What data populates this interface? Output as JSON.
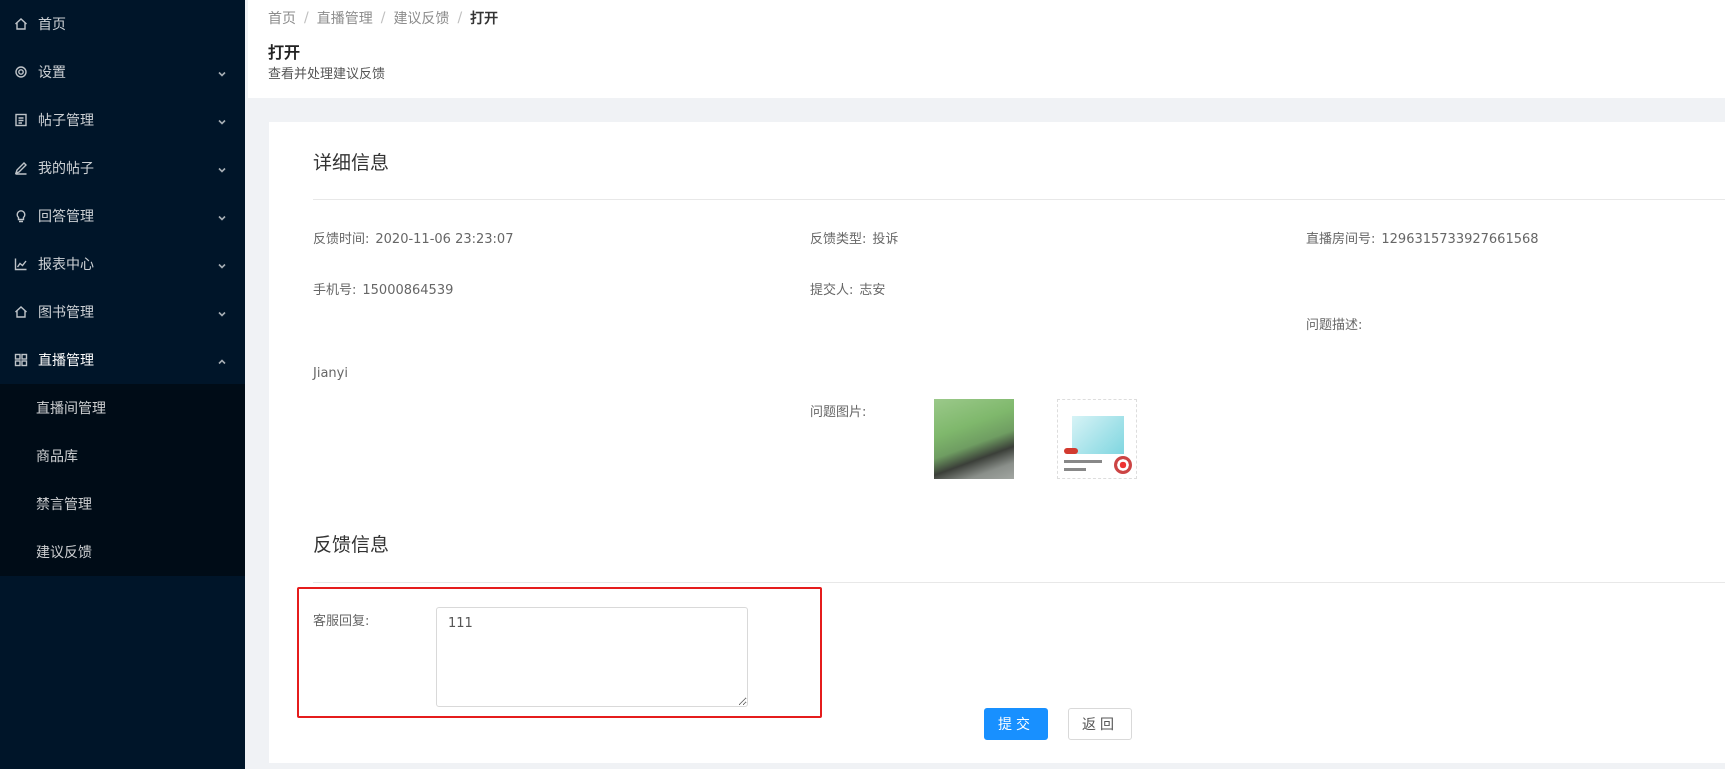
{
  "sidebar": {
    "items": [
      {
        "label": "首页",
        "icon": "home-icon"
      },
      {
        "label": "设置",
        "icon": "gear-icon"
      },
      {
        "label": "帖子管理",
        "icon": "file-text-icon"
      },
      {
        "label": "我的帖子",
        "icon": "edit-icon"
      },
      {
        "label": "回答管理",
        "icon": "bulb-icon"
      },
      {
        "label": "报表中心",
        "icon": "line-chart-icon"
      },
      {
        "label": "图书管理",
        "icon": "home-icon"
      },
      {
        "label": "直播管理",
        "icon": "appstore-icon"
      }
    ],
    "submenu": [
      "直播间管理",
      "商品库",
      "禁言管理",
      "建议反馈"
    ]
  },
  "breadcrumb": {
    "items": [
      "首页",
      "直播管理",
      "建议反馈"
    ],
    "current": "打开",
    "separator": "/"
  },
  "header": {
    "title": "打开",
    "subtitle": "查看并处理建议反馈"
  },
  "detail": {
    "title": "详细信息",
    "feedback_time_label": "反馈时间:",
    "feedback_time": "2020-11-06 23:23:07",
    "feedback_type_label": "反馈类型:",
    "feedback_type": "投诉",
    "room_id_label": "直播房间号:",
    "room_id": "1296315733927661568",
    "phone_label": "手机号:",
    "phone": "15000864539",
    "submitter_label": "提交人:",
    "submitter": "志安",
    "description_label": "问题描述:",
    "description": "Jianyi",
    "images_label": "问题图片:"
  },
  "feedback": {
    "title": "反馈信息",
    "reply_label": "客服回复:",
    "reply_value": "111"
  },
  "buttons": {
    "submit": "提交",
    "back": "返回"
  },
  "colors": {
    "sidebar_bg": "#001529",
    "primary": "#1890ff",
    "highlight": "#e51c1c"
  }
}
